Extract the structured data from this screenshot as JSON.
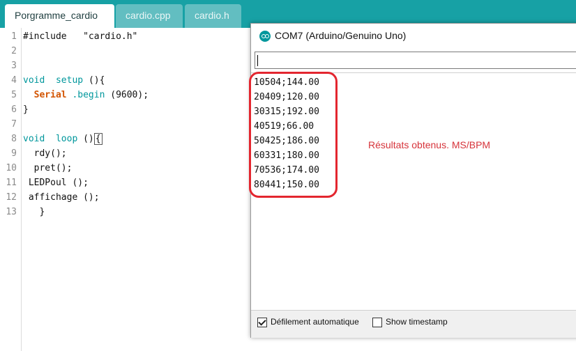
{
  "tabs": [
    {
      "label": "Porgramme_cardio"
    },
    {
      "label": "cardio.cpp"
    },
    {
      "label": "cardio.h"
    }
  ],
  "editor": {
    "line_numbers": [
      "1",
      "2",
      "3",
      "4",
      "5",
      "6",
      "7",
      "8",
      "9",
      "10",
      "11",
      "12",
      "13"
    ],
    "include_directive": "#include",
    "include_file": "\"cardio.h\"",
    "kw_void": "void",
    "fn_setup": "setup",
    "parens_open_brace": "(){",
    "fn_serial": "Serial",
    "fn_begin": ".begin",
    "begin_args": "(9600);",
    "close_brace": "}",
    "fn_loop": "loop",
    "loop_parens": "()",
    "loop_brace": "{",
    "line9": "rdy();",
    "line10": "pret();",
    "line11": "LEDPoul ();",
    "line12": "affichage ();",
    "line13": "}"
  },
  "monitor": {
    "title": "COM7 (Arduino/Genuino Uno)",
    "input_value": "",
    "output_lines": [
      "10504;144.00",
      "20409;120.00",
      "30315;192.00",
      "40519;66.00",
      "50425;186.00",
      "60331;180.00",
      "70536;174.00",
      "80441;150.00"
    ],
    "annotation": "Résultats obtenus. MS/BPM",
    "autoscroll_label": "Défilement automatique",
    "autoscroll_checked": true,
    "timestamp_label": "Show timestamp",
    "timestamp_checked": false
  },
  "colors": {
    "tabbar": "#17a1a5",
    "keyword": "#00979c",
    "function": "#d35400",
    "highlight": "#e3262f",
    "annotation": "#d6333a"
  }
}
